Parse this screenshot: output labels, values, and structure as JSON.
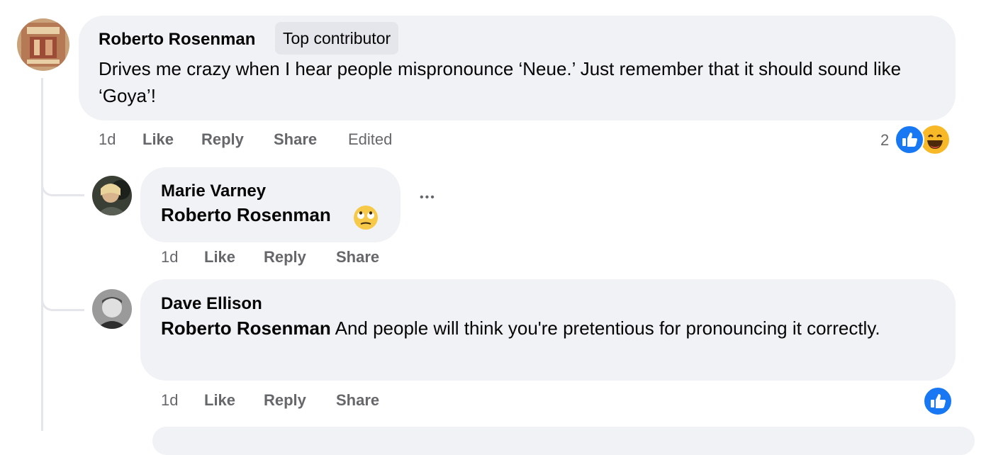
{
  "comments": [
    {
      "author": "Roberto Rosenman",
      "badge": "Top contributor",
      "text": "Drives me crazy when I hear people mispronounce ‘Neue.’ Just remember that it should sound like ‘Goya’!",
      "actions": {
        "time": "1d",
        "like": "Like",
        "reply": "Reply",
        "share": "Share",
        "edited": "Edited"
      },
      "reactions": {
        "count": "2",
        "types": [
          "like-icon",
          "haha-icon"
        ]
      }
    },
    {
      "author": "Marie Varney",
      "mention": "Roberto Rosenman",
      "text": "",
      "emoji": "rolling-eyes-emoji",
      "actions": {
        "time": "1d",
        "like": "Like",
        "reply": "Reply",
        "share": "Share"
      },
      "more": "•••"
    },
    {
      "author": "Dave Ellison",
      "mention": "Roberto Rosenman",
      "text": " And people will think you're pretentious for pronouncing it correctly.",
      "actions": {
        "time": "1d",
        "like": "Like",
        "reply": "Reply",
        "share": "Share"
      },
      "reactions": {
        "types": [
          "like-icon"
        ]
      }
    }
  ],
  "colors": {
    "bubble": "#f0f2f5",
    "muted": "#65676b",
    "like_blue": "#1877f2",
    "haha_yellow": "#f7b928"
  }
}
